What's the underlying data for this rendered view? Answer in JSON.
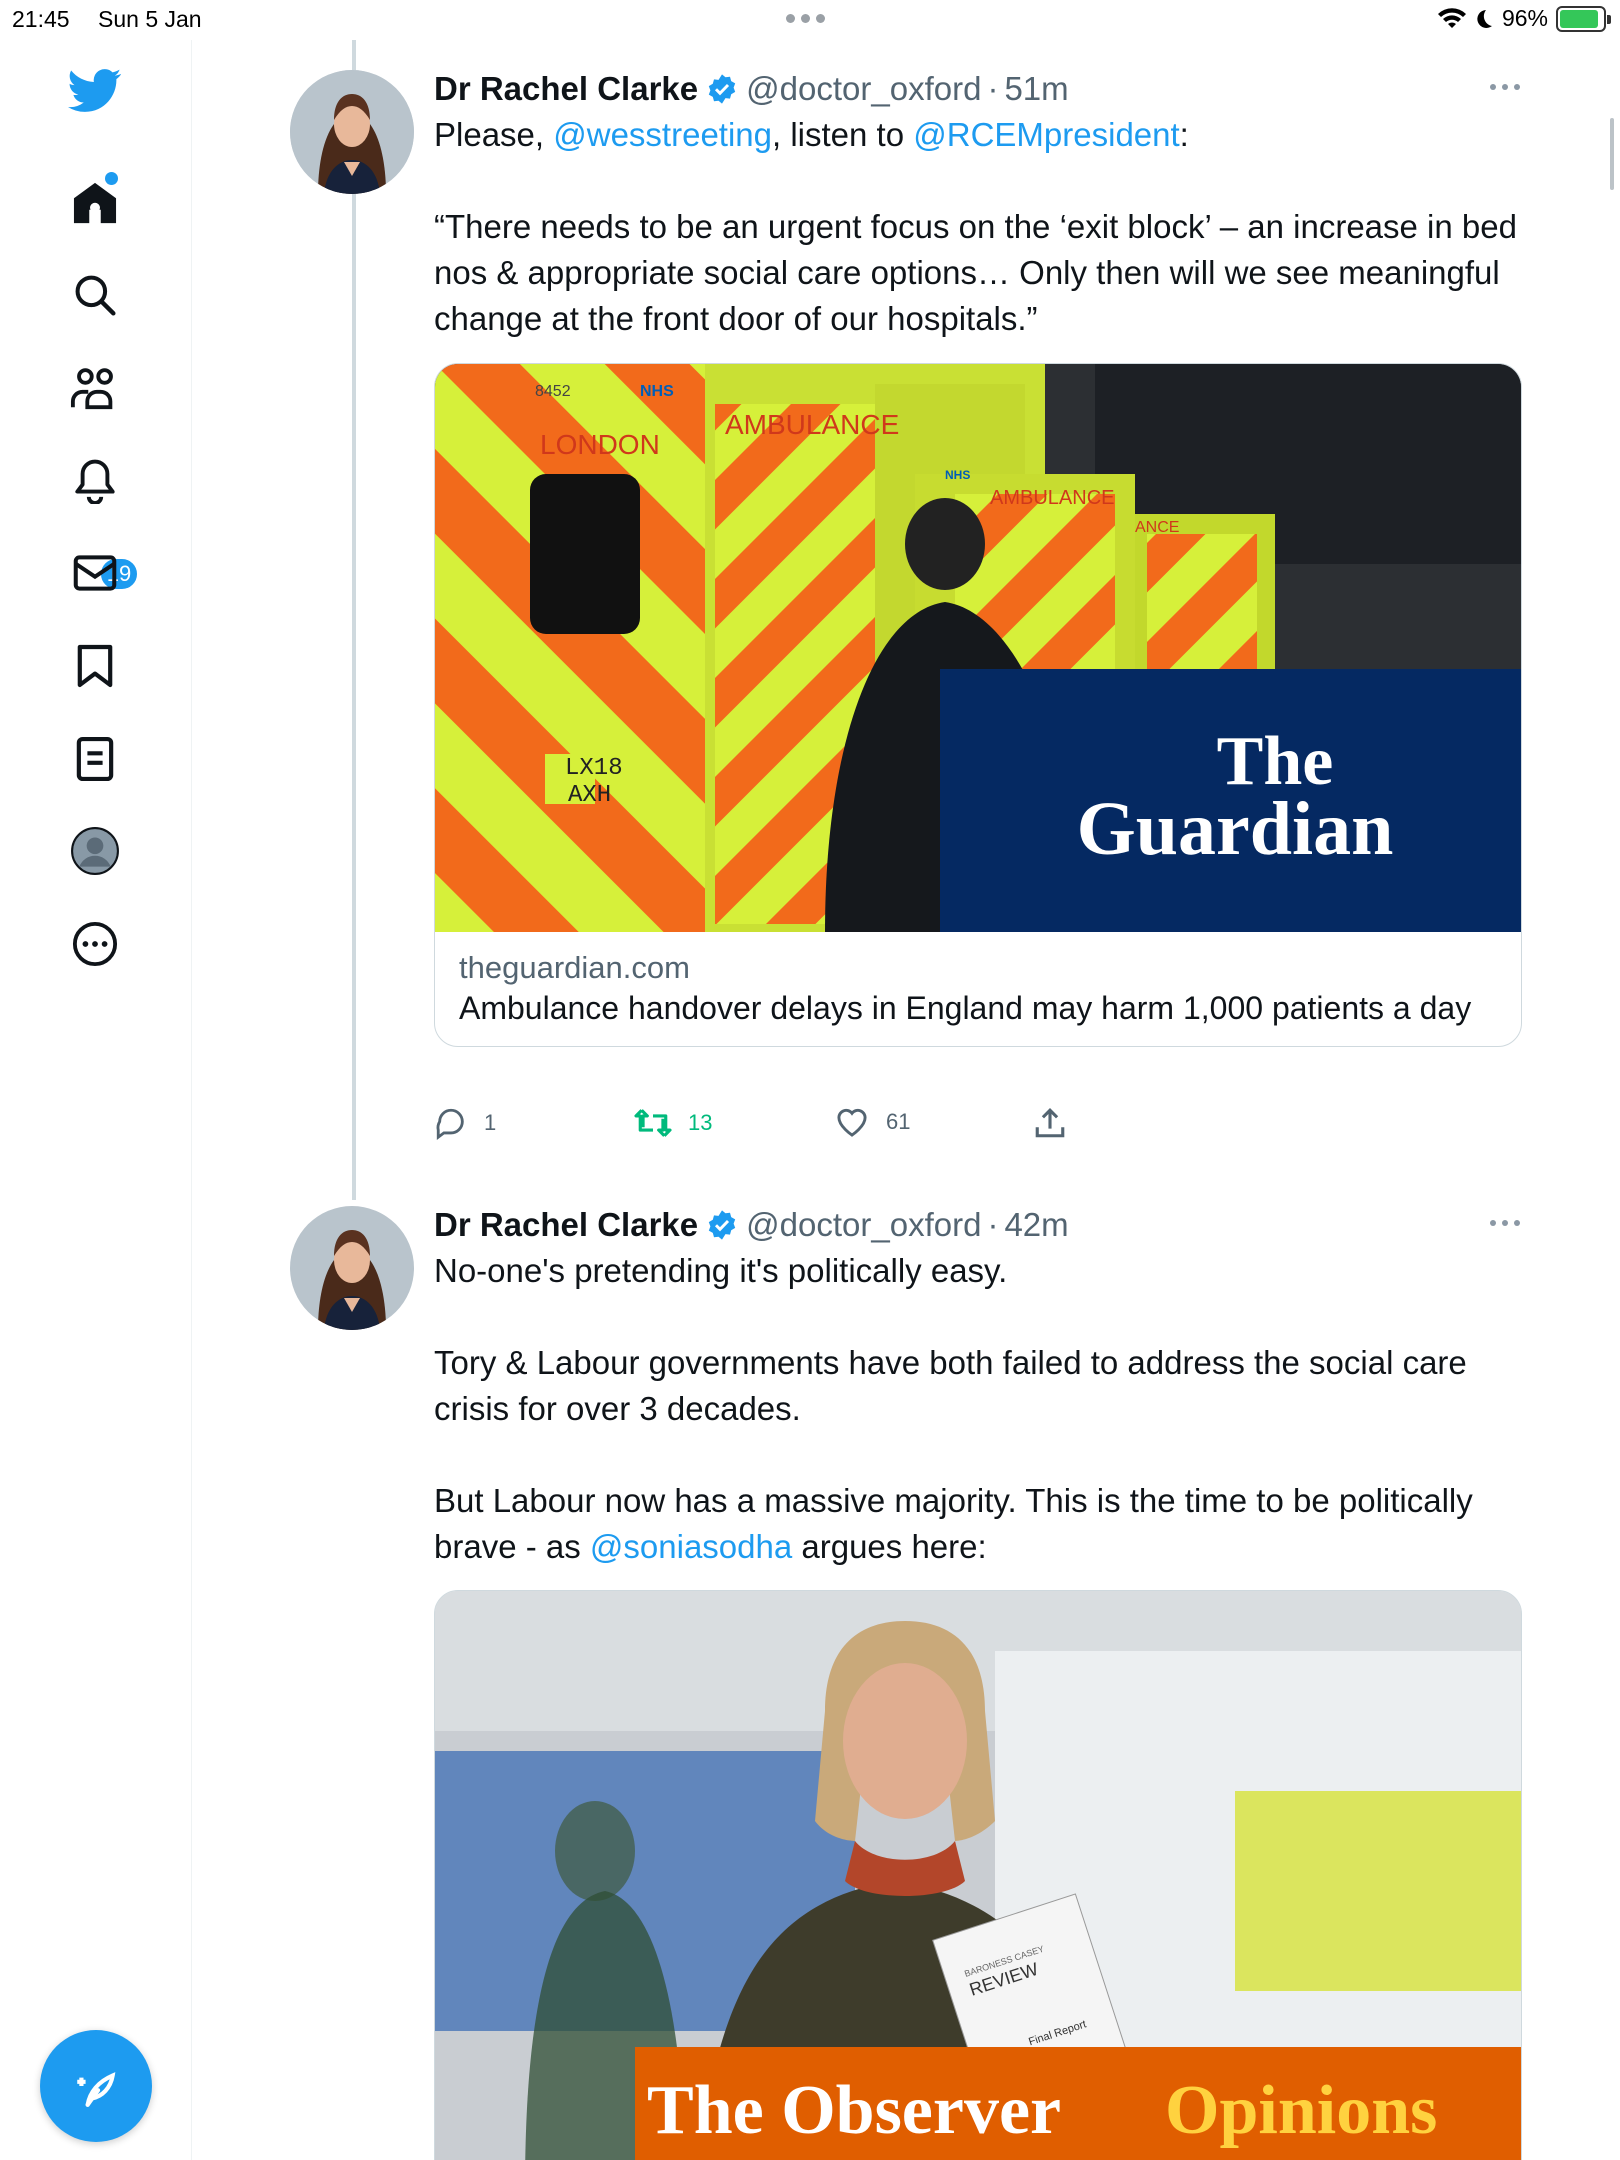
{
  "status_bar": {
    "time": "21:45",
    "date": "Sun 5 Jan",
    "battery": "96%"
  },
  "sidebar": {
    "notifications_badge": "19",
    "items": [
      {
        "name": "twitter-logo"
      },
      {
        "name": "home"
      },
      {
        "name": "explore"
      },
      {
        "name": "communities"
      },
      {
        "name": "notifications"
      },
      {
        "name": "messages"
      },
      {
        "name": "bookmarks"
      },
      {
        "name": "lists"
      },
      {
        "name": "profile"
      },
      {
        "name": "more"
      }
    ]
  },
  "tweets": [
    {
      "author": "Dr Rachel Clarke",
      "handle": "@doctor_oxford",
      "sep": "·",
      "time": "51m",
      "text_line1_pre": "Please, ",
      "text_line1_mention1": "@wesstreeting",
      "text_line1_mid": ", listen to ",
      "text_line1_mention2": "@RCEMpresident",
      "text_line1_post": ":",
      "quote": "“There needs to be an urgent focus on the ‘exit block’ – an increase in bed nos & appropriate social care options… Only then will we see meaningful change at the front door of our hospitals.”",
      "card": {
        "domain": "theguardian.com",
        "title": "Ambulance handover delays in England may harm 1,000 patients a day",
        "image_labels": {
          "vehicle_left": "LONDON",
          "vehicle_mid": "AMBULANCE",
          "vehicle_right": "AMBULANCE",
          "vehicle_far": "ANCE",
          "plate_top": "LX18",
          "plate_bottom": "AXH",
          "fleet_no": "8452",
          "nhs": "NHS",
          "nhs_right": "NHS",
          "brand_line1": "The",
          "brand_line2": "Guardian"
        }
      },
      "replies": "1",
      "retweets": "13",
      "likes": "61"
    },
    {
      "author": "Dr Rachel Clarke",
      "handle": "@doctor_oxford",
      "sep": "·",
      "time": "42m",
      "para1": "No-one's pretending it's politically easy.",
      "para2": "Tory & Labour governments have both failed to address the social care crisis for over 3 decades.",
      "para3_pre": "But Labour now has a massive majority. This is the time to be politically brave - as ",
      "para3_mention": "@soniasodha",
      "para3_post": " argues here:",
      "card": {
        "image_labels": {
          "report_line1": "BARONESS CASEY",
          "report_line2": "REVIEW",
          "report_line3": "Final Report",
          "brand_part1": "The Observer",
          "brand_part2": "Opinions"
        }
      }
    }
  ],
  "colors": {
    "accent": "#1d9bf0",
    "retweet_green": "#00ba7c",
    "guardian_blue": "#052962",
    "observer_orange": "#e05e00"
  }
}
